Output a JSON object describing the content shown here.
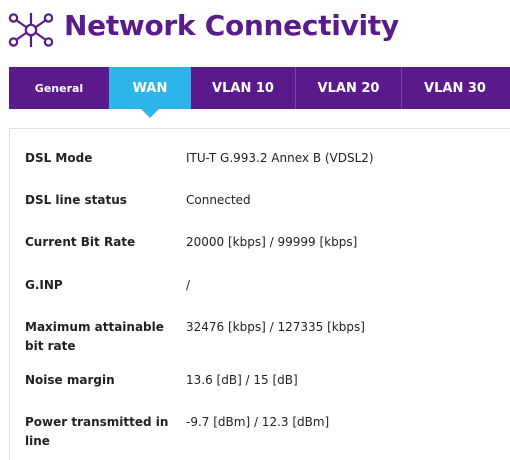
{
  "header": {
    "title": "Network Connectivity",
    "logo_icon": "network-nodes-icon"
  },
  "colors": {
    "brand": "#5a1a8c",
    "active_tab": "#2eb4e8"
  },
  "tabs": [
    {
      "label": "General",
      "active": false
    },
    {
      "label": "WAN",
      "active": true
    },
    {
      "label": "VLAN 10",
      "active": false
    },
    {
      "label": "VLAN 20",
      "active": false
    },
    {
      "label": "VLAN 30",
      "active": false
    }
  ],
  "rows": [
    {
      "label": "DSL Mode",
      "value": "ITU-T G.993.2 Annex B (VDSL2)"
    },
    {
      "label": "DSL line status",
      "value": "Connected"
    },
    {
      "label": "Current Bit Rate",
      "value": "20000 [kbps] / 99999 [kbps]"
    },
    {
      "label": "G.INP",
      "value": "/"
    },
    {
      "label": "Maximum attainable bit rate",
      "value": "32476 [kbps] / 127335 [kbps]"
    },
    {
      "label": "Noise margin",
      "value": "13.6 [dB] / 15 [dB]"
    },
    {
      "label": "Power transmitted in line",
      "value": "-9.7 [dBm] / 12.3 [dBm]"
    }
  ]
}
